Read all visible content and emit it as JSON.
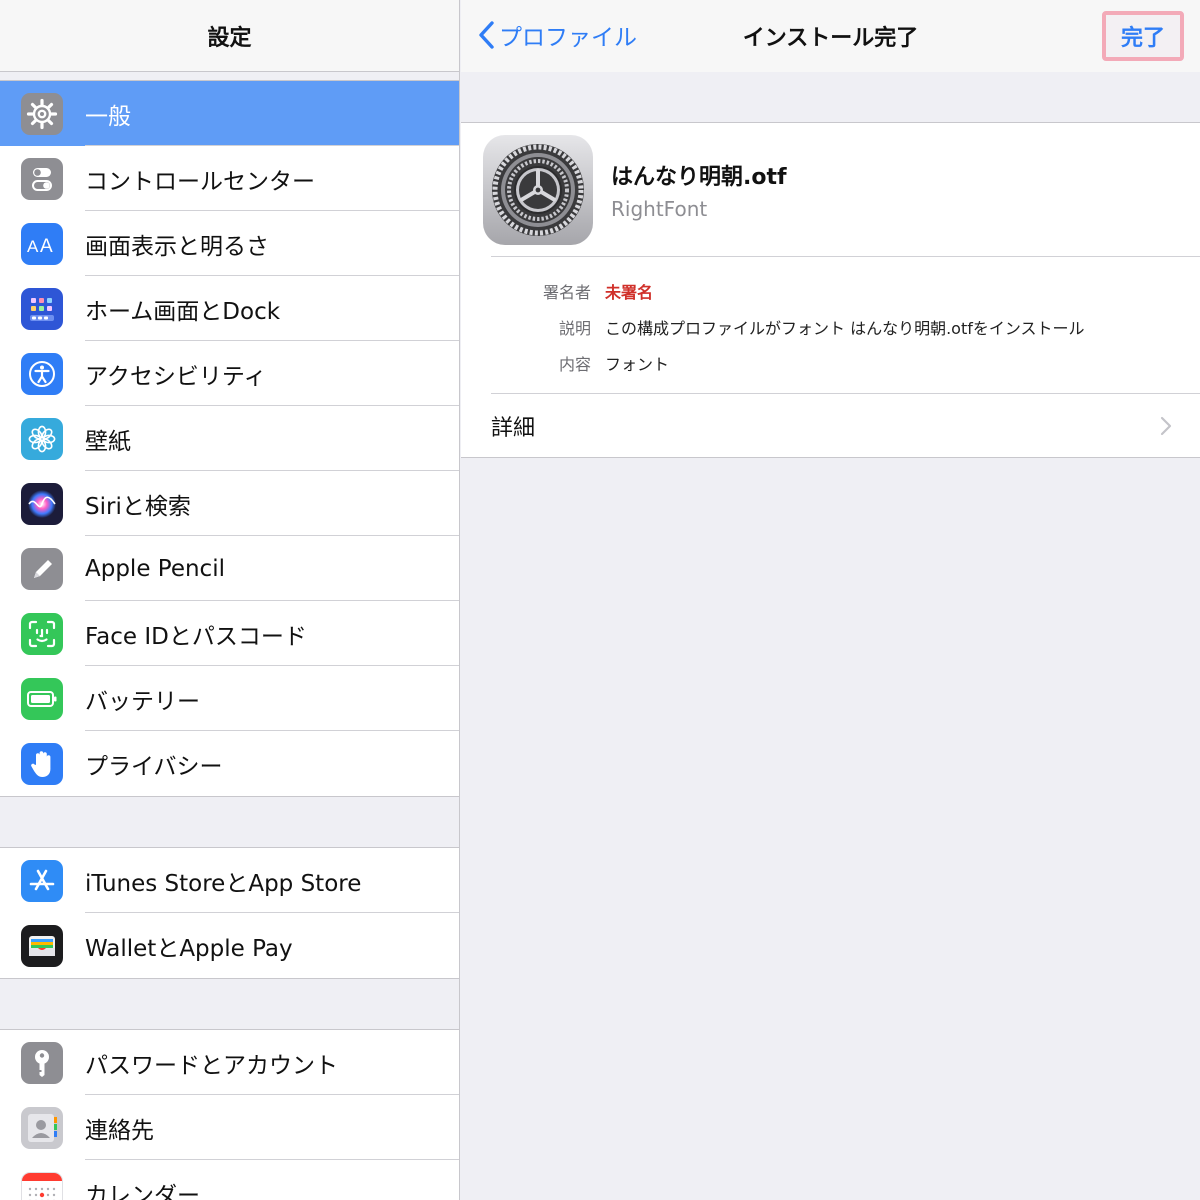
{
  "sidebar": {
    "title": "設定",
    "groups": [
      {
        "items": [
          {
            "label": "一般",
            "icon": "gear-icon",
            "color": "#8e8e93",
            "selected": true
          },
          {
            "label": "コントロールセンター",
            "icon": "toggle-icon",
            "color": "#8e8e93"
          },
          {
            "label": "画面表示と明るさ",
            "icon": "text-size-icon",
            "color": "#2f7df6"
          },
          {
            "label": "ホーム画面とDock",
            "icon": "home-grid-icon",
            "color": "#2e56d6"
          },
          {
            "label": "アクセシビリティ",
            "icon": "accessibility-icon",
            "color": "#2f7df6"
          },
          {
            "label": "壁紙",
            "icon": "flower-icon",
            "color": "#36aadc"
          },
          {
            "label": "Siriと検索",
            "icon": "siri-icon",
            "color": "#1c1c3a"
          },
          {
            "label": "Apple Pencil",
            "icon": "pencil-icon",
            "color": "#8e8e93"
          },
          {
            "label": "Face IDとパスコード",
            "icon": "face-id-icon",
            "color": "#34c759"
          },
          {
            "label": "バッテリー",
            "icon": "battery-icon",
            "color": "#34c759"
          },
          {
            "label": "プライバシー",
            "icon": "hand-icon",
            "color": "#2f7df6"
          }
        ]
      },
      {
        "items": [
          {
            "label": "iTunes StoreとApp Store",
            "icon": "app-store-icon",
            "color": "#2f8cf6"
          },
          {
            "label": "WalletとApple Pay",
            "icon": "wallet-icon",
            "color": "#1c1c1e"
          }
        ]
      },
      {
        "items": [
          {
            "label": "パスワードとアカウント",
            "icon": "key-icon",
            "color": "#8e8e93"
          },
          {
            "label": "連絡先",
            "icon": "contacts-icon",
            "color": "#c9c9ce"
          },
          {
            "label": "カレンダー",
            "icon": "calendar-icon",
            "color": "#ffffff"
          }
        ]
      }
    ]
  },
  "navbar": {
    "back_label": "プロファイル",
    "title": "インストール完了",
    "done_label": "完了"
  },
  "profile": {
    "name": "はんなり明朝.otf",
    "org": "RightFont",
    "details": [
      {
        "key": "署名者",
        "value": "未署名",
        "warn": true
      },
      {
        "key": "説明",
        "value": "この構成プロファイルがフォント はんなり明朝.otfをインストール"
      },
      {
        "key": "内容",
        "value": "フォント"
      }
    ],
    "more_label": "詳細"
  },
  "colors": {
    "accent": "#2f7df6",
    "selected_row": "#5f9cf6",
    "warning": "#d0302a",
    "highlight_border": "#f3aab8"
  }
}
